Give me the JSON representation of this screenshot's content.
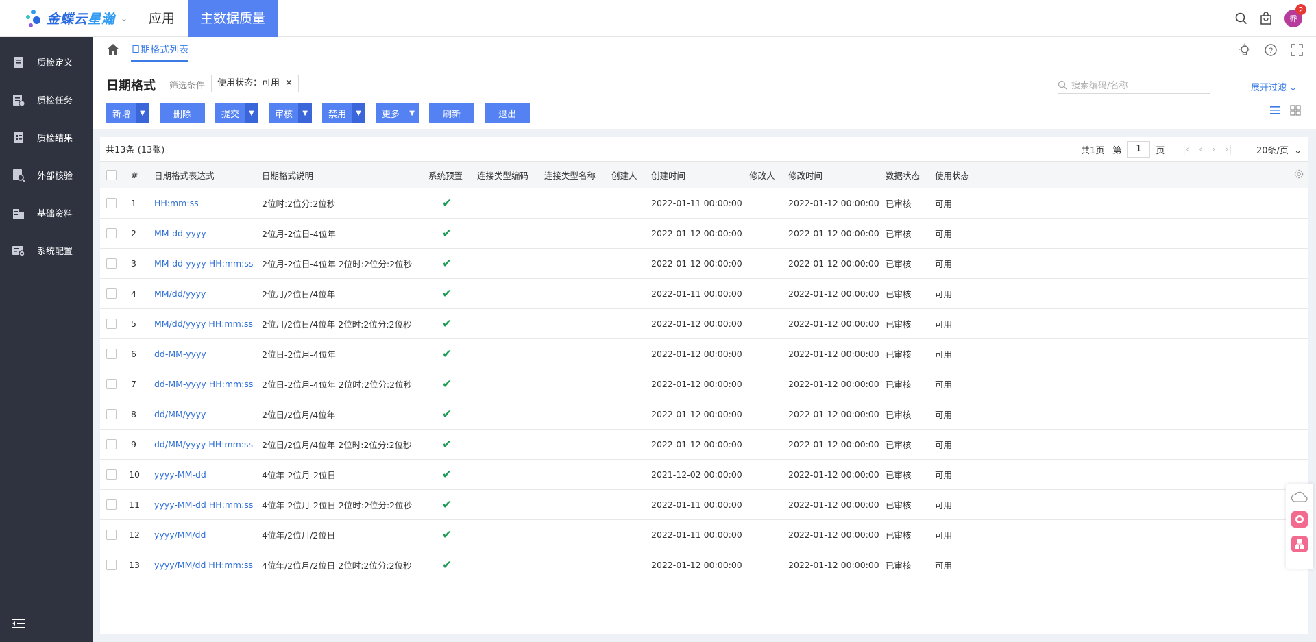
{
  "topbar": {
    "brand_a": "金蝶云",
    "brand_b": "星瀚",
    "nav_app": "应用",
    "nav_active": "主数据质量",
    "avatar": "乔",
    "badge_count": "2"
  },
  "sidebar": {
    "items": [
      {
        "label": "质检定义",
        "icon": "book-icon"
      },
      {
        "label": "质检任务",
        "icon": "task-icon"
      },
      {
        "label": "质检结果",
        "icon": "result-icon"
      },
      {
        "label": "外部核验",
        "icon": "verify-icon"
      },
      {
        "label": "基础资料",
        "icon": "building-icon"
      },
      {
        "label": "系统配置",
        "icon": "config-icon"
      }
    ]
  },
  "breadcrumb": {
    "label": "日期格式列表"
  },
  "header": {
    "title": "日期格式",
    "filter_label": "筛选条件",
    "filter_tag": "使用状态：可用",
    "search_placeholder": "搜索编码/名称",
    "expand_filter": "展开过滤"
  },
  "toolbar": {
    "add": "新增",
    "delete": "删除",
    "submit": "提交",
    "audit": "审核",
    "disable": "禁用",
    "more": "更多",
    "refresh": "刷新",
    "exit": "退出"
  },
  "pager": {
    "count": "共13条 (13张)",
    "total_pages": "共1页",
    "page_prefix": "第",
    "page_no": "1",
    "page_suffix": "页",
    "page_size": "20条/页"
  },
  "table": {
    "columns": [
      "#",
      "日期格式表达式",
      "日期格式说明",
      "系统预置",
      "连接类型编码",
      "连接类型名称",
      "创建人",
      "创建时间",
      "修改人",
      "修改时间",
      "数据状态",
      "使用状态"
    ],
    "rows": [
      {
        "no": "1",
        "expr": "HH:mm:ss",
        "desc": "2位时:2位分:2位秒",
        "created": "2022-01-11 00:00:00",
        "modified": "2022-01-12 00:00:00",
        "data_status": "已审核",
        "use_status": "可用"
      },
      {
        "no": "2",
        "expr": "MM-dd-yyyy",
        "desc": "2位月-2位日-4位年",
        "created": "2022-01-12 00:00:00",
        "modified": "2022-01-12 00:00:00",
        "data_status": "已审核",
        "use_status": "可用"
      },
      {
        "no": "3",
        "expr": "MM-dd-yyyy HH:mm:ss",
        "desc": "2位月-2位日-4位年 2位时:2位分:2位秒",
        "created": "2022-01-12 00:00:00",
        "modified": "2022-01-12 00:00:00",
        "data_status": "已审核",
        "use_status": "可用"
      },
      {
        "no": "4",
        "expr": "MM/dd/yyyy",
        "desc": "2位月/2位日/4位年",
        "created": "2022-01-11 00:00:00",
        "modified": "2022-01-12 00:00:00",
        "data_status": "已审核",
        "use_status": "可用"
      },
      {
        "no": "5",
        "expr": "MM/dd/yyyy HH:mm:ss",
        "desc": "2位月/2位日/4位年 2位时:2位分:2位秒",
        "created": "2022-01-12 00:00:00",
        "modified": "2022-01-12 00:00:00",
        "data_status": "已审核",
        "use_status": "可用"
      },
      {
        "no": "6",
        "expr": "dd-MM-yyyy",
        "desc": "2位日-2位月-4位年",
        "created": "2022-01-12 00:00:00",
        "modified": "2022-01-12 00:00:00",
        "data_status": "已审核",
        "use_status": "可用"
      },
      {
        "no": "7",
        "expr": "dd-MM-yyyy HH:mm:ss",
        "desc": "2位日-2位月-4位年 2位时:2位分:2位秒",
        "created": "2022-01-12 00:00:00",
        "modified": "2022-01-12 00:00:00",
        "data_status": "已审核",
        "use_status": "可用"
      },
      {
        "no": "8",
        "expr": "dd/MM/yyyy",
        "desc": "2位日/2位月/4位年",
        "created": "2022-01-12 00:00:00",
        "modified": "2022-01-12 00:00:00",
        "data_status": "已审核",
        "use_status": "可用"
      },
      {
        "no": "9",
        "expr": "dd/MM/yyyy HH:mm:ss",
        "desc": "2位日/2位月/4位年 2位时:2位分:2位秒",
        "created": "2022-01-12 00:00:00",
        "modified": "2022-01-12 00:00:00",
        "data_status": "已审核",
        "use_status": "可用"
      },
      {
        "no": "10",
        "expr": "yyyy-MM-dd",
        "desc": "4位年-2位月-2位日",
        "created": "2021-12-02 00:00:00",
        "modified": "2022-01-12 00:00:00",
        "data_status": "已审核",
        "use_status": "可用"
      },
      {
        "no": "11",
        "expr": "yyyy-MM-dd HH:mm:ss",
        "desc": "4位年-2位月-2位日 2位时:2位分:2位秒",
        "created": "2022-01-11 00:00:00",
        "modified": "2022-01-12 00:00:00",
        "data_status": "已审核",
        "use_status": "可用"
      },
      {
        "no": "12",
        "expr": "yyyy/MM/dd",
        "desc": "4位年/2位月/2位日",
        "created": "2022-01-11 00:00:00",
        "modified": "2022-01-12 00:00:00",
        "data_status": "已审核",
        "use_status": "可用"
      },
      {
        "no": "13",
        "expr": "yyyy/MM/dd HH:mm:ss",
        "desc": "4位年/2位月/2位日 2位时:2位分:2位秒",
        "created": "2022-01-12 00:00:00",
        "modified": "2022-01-12 00:00:00",
        "data_status": "已审核",
        "use_status": "可用"
      }
    ]
  },
  "colors": {
    "accent": "#5582f3",
    "sidebar": "#2f3340",
    "link": "#2f6fd6",
    "check": "#1d9a55"
  }
}
